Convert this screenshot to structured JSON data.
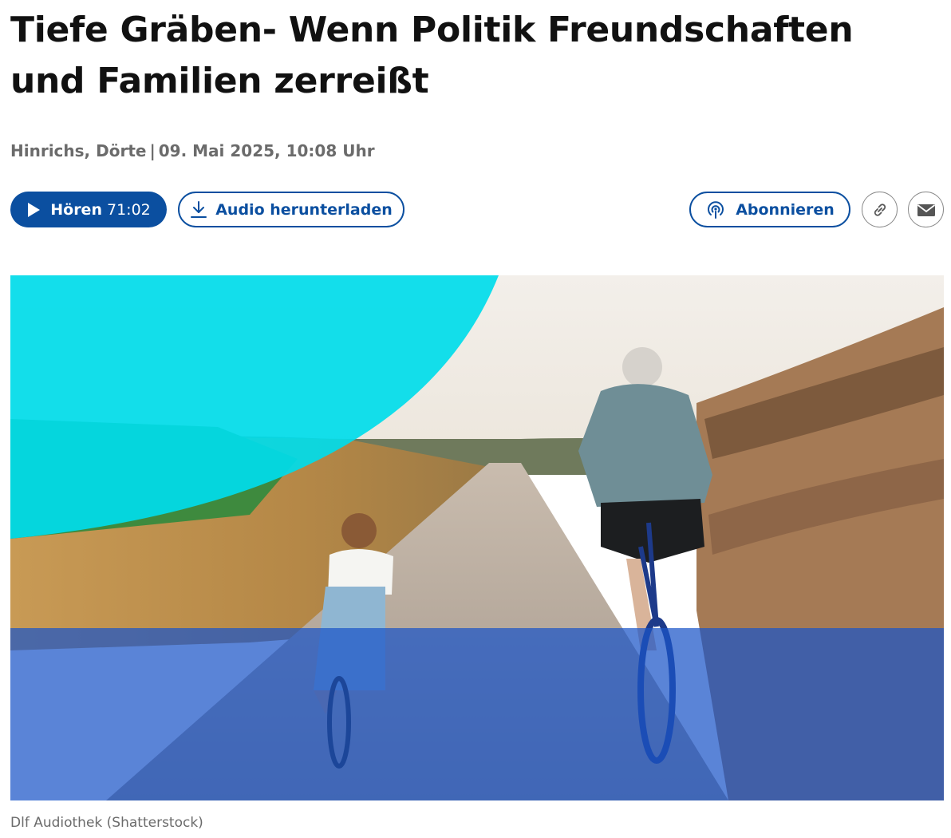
{
  "article": {
    "title": "Tiefe Gräben- Wenn Politik Freundschaften und Familien zerreißt",
    "author": "Hinrichs, Dörte",
    "separator": "|",
    "date": "09. Mai 2025, 10:08 Uhr"
  },
  "actions": {
    "play_label": "Hören",
    "play_duration": "71:02",
    "download_label": "Audio herunterladen",
    "subscribe_label": "Abonnieren",
    "link_icon": "link-icon",
    "mail_icon": "mail-icon"
  },
  "hero": {
    "caption": "Dlf Audiothek (Shatterstock)"
  },
  "colors": {
    "brand_blue": "#0b4fa0",
    "cyan_overlay": "#00dcea",
    "blue_overlay": "#1a55c8"
  }
}
